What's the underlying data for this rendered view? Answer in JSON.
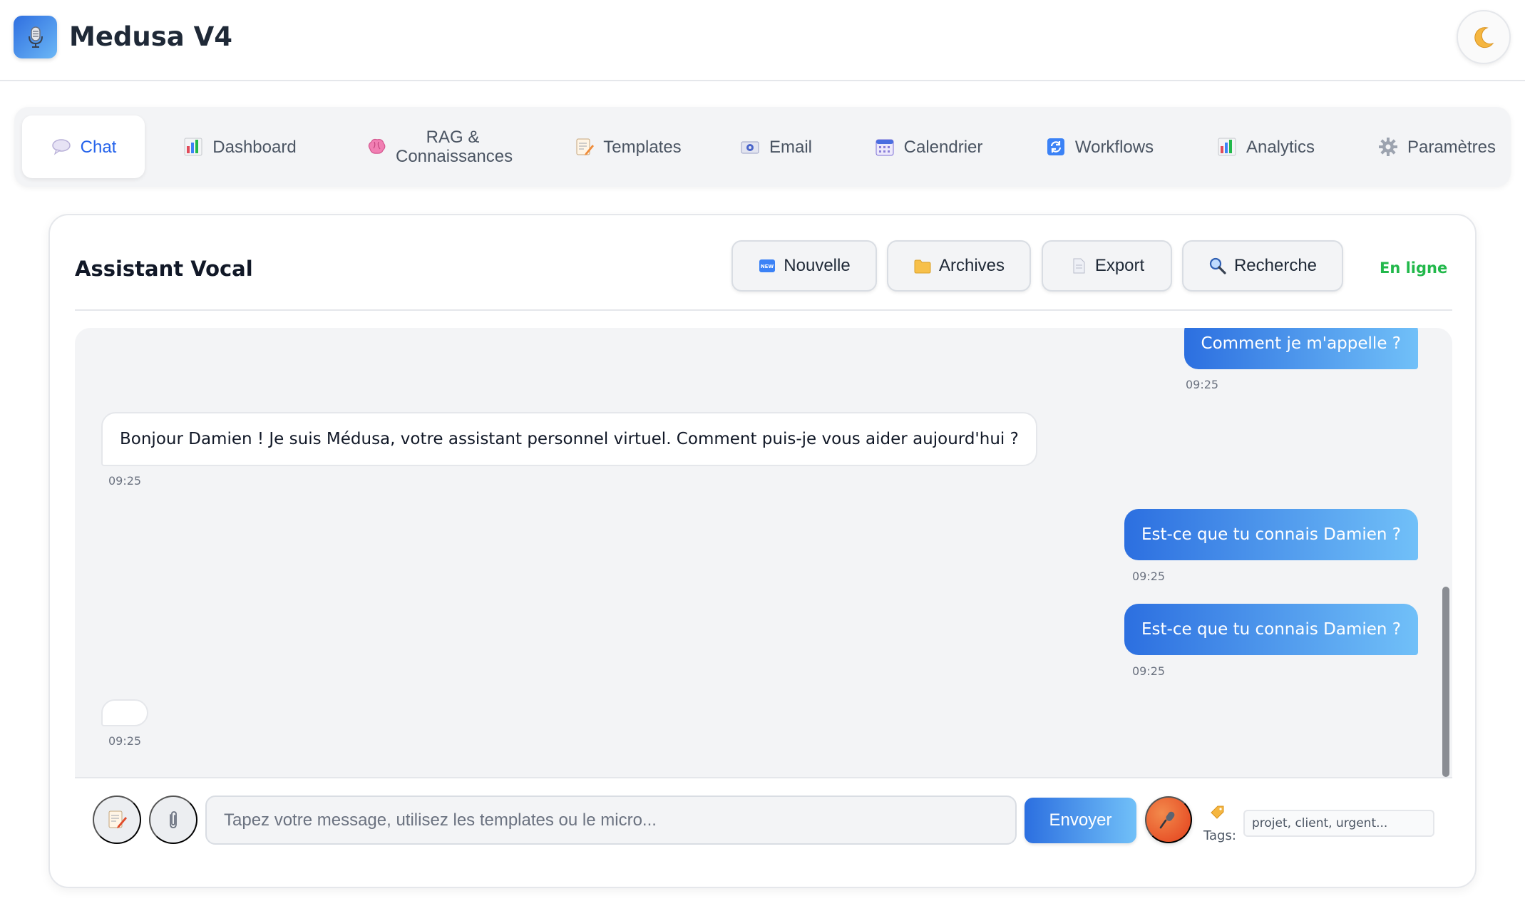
{
  "app": {
    "title": "Medusa V4",
    "logo_icon": "microphone-icon",
    "theme_icon": "moon-icon"
  },
  "nav": {
    "tabs": [
      {
        "label": "Chat",
        "icon": "chat-bubble-icon",
        "active": true
      },
      {
        "label": "Dashboard",
        "icon": "bar-chart-icon",
        "active": false
      },
      {
        "label": "RAG & Connaissances",
        "icon": "brain-icon",
        "active": false
      },
      {
        "label": "Templates",
        "icon": "memo-icon",
        "active": false
      },
      {
        "label": "Email",
        "icon": "email-icon",
        "active": false
      },
      {
        "label": "Calendrier",
        "icon": "calendar-icon",
        "active": false
      },
      {
        "label": "Workflows",
        "icon": "refresh-icon",
        "active": false
      },
      {
        "label": "Analytics",
        "icon": "bar-chart-icon",
        "active": false
      },
      {
        "label": "Paramètres",
        "icon": "gear-icon",
        "active": false
      }
    ]
  },
  "chat": {
    "title": "Assistant Vocal",
    "status": "En ligne",
    "toolbar": {
      "new_label": "Nouvelle",
      "archives_label": "Archives",
      "export_label": "Export",
      "search_label": "Recherche"
    },
    "messages": [
      {
        "role": "user",
        "text": "Comment je m'appelle ?",
        "time": "09:25"
      },
      {
        "role": "assistant",
        "text": "Bonjour Damien ! Je suis Médusa, votre assistant personnel virtuel. Comment puis-je vous aider aujourd'hui ?",
        "time": "09:25"
      },
      {
        "role": "user",
        "text": "Est-ce que tu connais Damien ?",
        "time": "09:25"
      },
      {
        "role": "user",
        "text": "Est-ce que tu connais Damien ?",
        "time": "09:25"
      },
      {
        "role": "assistant",
        "text": "",
        "time": "09:25"
      }
    ],
    "input": {
      "placeholder": "Tapez votre message, utilisez les templates ou le micro...",
      "value": "",
      "send_label": "Envoyer",
      "tags_label": "Tags:",
      "tags_placeholder": "projet, client, urgent...",
      "tags_value": ""
    }
  },
  "colors": {
    "accent": "#2563eb",
    "online": "#22b84b",
    "user_bubble_start": "#2c6fe0",
    "user_bubble_end": "#71c0f8",
    "mic": "#e8552a"
  }
}
